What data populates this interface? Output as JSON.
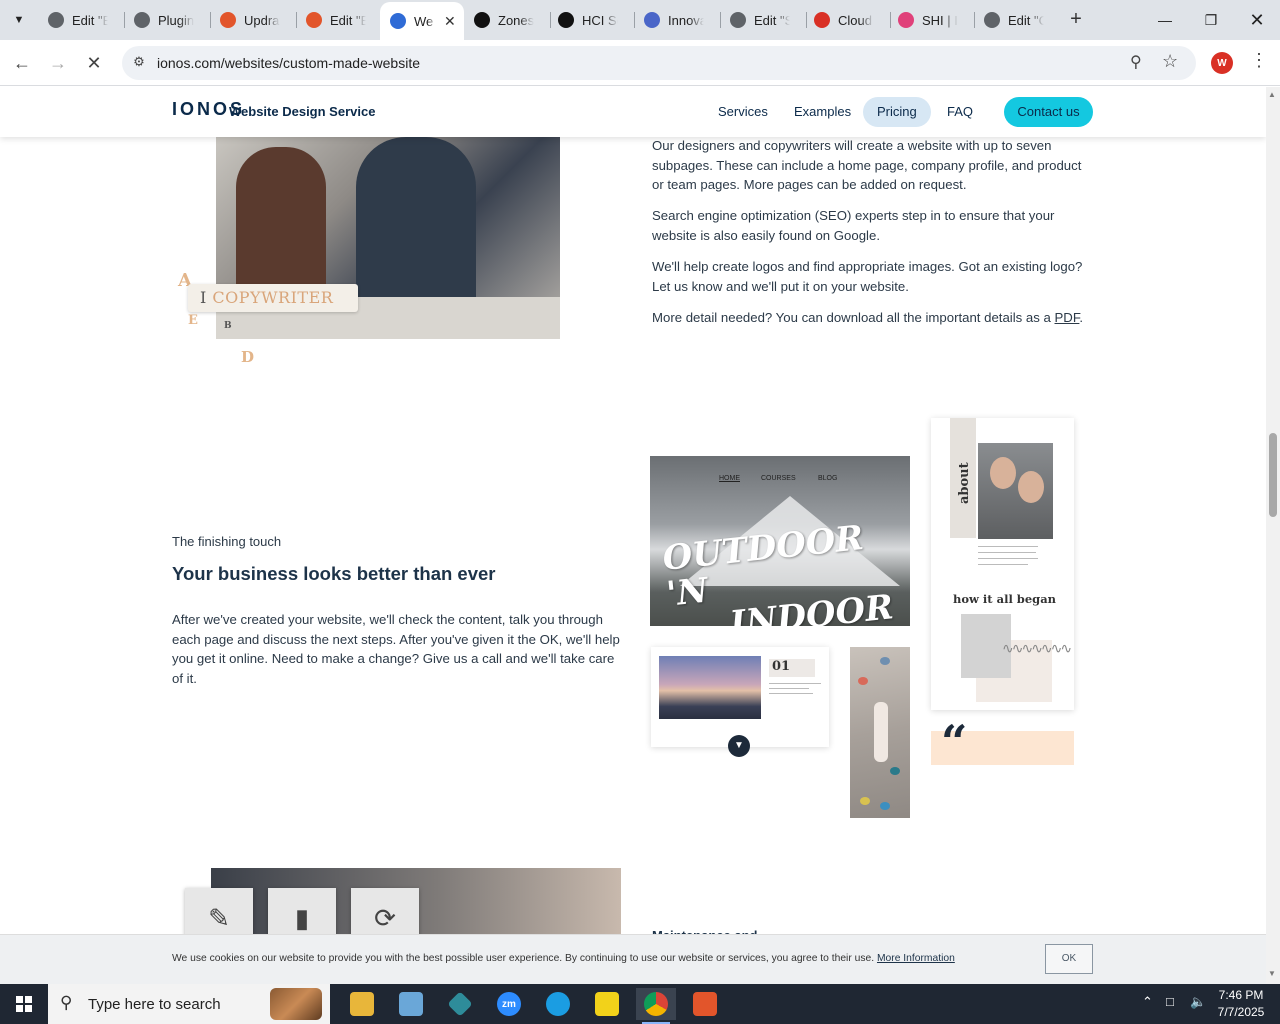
{
  "browser": {
    "tabs": [
      {
        "title": "Edit \"El",
        "fav_color": "#5f6368",
        "fav_glyph": "globe-icon"
      },
      {
        "title": "Plugins",
        "fav_color": "#5f6368",
        "fav_glyph": "globe-icon"
      },
      {
        "title": "Updraf",
        "fav_color": "#e2552b",
        "fav_glyph": "square-icon"
      },
      {
        "title": "Edit \"El",
        "fav_color": "#e2552b",
        "fav_glyph": "square-icon"
      },
      {
        "title": "We",
        "fav_color": "#2f6bd6",
        "fav_glyph": "ionos-icon",
        "active": true
      },
      {
        "title": "Zones",
        "fav_color": "#111111",
        "fav_glyph": "z-icon"
      },
      {
        "title": "HCI So",
        "fav_color": "#111111",
        "fav_glyph": "openai-icon"
      },
      {
        "title": "Innova",
        "fav_color": "#4a66c8",
        "fav_glyph": "swirl-icon"
      },
      {
        "title": "Edit \"St",
        "fav_color": "#5f6368",
        "fav_glyph": "globe-icon"
      },
      {
        "title": "Cloud",
        "fav_color": "#d93025",
        "fav_glyph": "cloud-icon"
      },
      {
        "title": "SHI | In",
        "fav_color": "#e0417a",
        "fav_glyph": "ring-icon"
      },
      {
        "title": "Edit \"C",
        "fav_color": "#5f6368",
        "fav_glyph": "globe-icon"
      }
    ],
    "url": "ionos.com/websites/custom-made-website",
    "profile_initial": "W"
  },
  "site": {
    "logo": "IONOS",
    "logo_sub": "Website Design Service",
    "nav": [
      "Services",
      "Examples",
      "Pricing",
      "FAQ"
    ],
    "contact": "Contact us"
  },
  "content": {
    "para1": "Our designers and copywriters will create a website with up to seven subpages. These can include a home page, company profile, and product or team pages. More pages can be added on request.",
    "para2": "Search engine optimization (SEO) experts step in to ensure that your website is also easily found on Google.",
    "para3": "We'll help create logos and find appropriate images. Got an existing logo? Let us know and we'll put it on your website.",
    "para4_prefix": "More detail needed? You can download all the important details as a ",
    "para4_link": "PDF",
    "para4_suffix": ".",
    "copywriter_tag": "COPYWRITER",
    "deco_letters": [
      "A",
      "E",
      "B",
      "D"
    ],
    "eyebrow": "The finishing touch",
    "heading": "Your business looks better than ever",
    "para5": "After we've created your website, we'll check the content, talk you through each page and discuss the next steps. After you've given it the OK, we'll help you get it online. Need to make a change? Give us a call and we'll take care of it.",
    "partial_heading": "Maintenance and"
  },
  "mockup": {
    "nav": [
      "HOME",
      "COURSES",
      "BLOG"
    ],
    "title_line1": "OUTDOOR 'N",
    "title_line2": "INDOOR",
    "about": "about",
    "story": "how it all began",
    "num": "01",
    "quote": "“"
  },
  "cookie": {
    "message": "We use cookies on our website to provide you with the best possible user experience. By continuing to use our website or services, you agree to their use.",
    "link": "More Information",
    "ok": "OK"
  },
  "taskbar": {
    "search_placeholder": "Type here to search",
    "time": "7:46 PM",
    "date": "7/7/2025"
  }
}
